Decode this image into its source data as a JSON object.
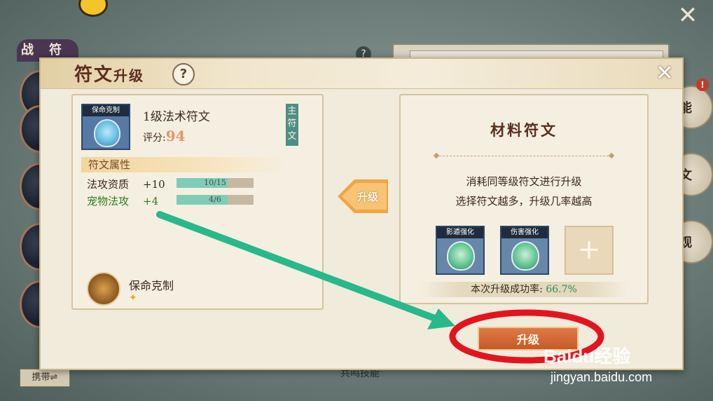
{
  "background": {
    "left_tabs": [
      "战",
      "符"
    ],
    "right_tabs": [
      "能",
      "文",
      "观"
    ],
    "red_dot": "!",
    "carry_button": "携带⇌",
    "resonance_label": "共鸣技能"
  },
  "dialog": {
    "title_main": "符文",
    "title_sub": "升级",
    "help": "?",
    "close": "✕",
    "left_card": {
      "rune_icon_label": "保命克制",
      "rune_name": "1级法术符文",
      "score_label": "评分:",
      "score_value": "94",
      "main_tag": "主符文",
      "attributes_header": "符文属性",
      "attributes": [
        {
          "name": "法攻资质",
          "plus": "+10",
          "progress_text": "10/15",
          "progress": 0.6667,
          "color": "#3b2a1e"
        },
        {
          "name": "宠物法攻",
          "plus": "+4",
          "progress_text": "4/6",
          "progress": 0.6667,
          "color": "#2e7d1f"
        }
      ],
      "skill_name": "保命克制"
    },
    "arrow_label": "升级",
    "right_card": {
      "title": "材料符文",
      "desc1": "消耗同等级符文进行升级",
      "desc2": "选择符文越多，升级几率越高",
      "slots": [
        "影遁强化",
        "伤害强化"
      ],
      "add": "+",
      "success_label": "本次升级成功率:",
      "success_value": "66.7%"
    },
    "upgrade_button": "升级"
  },
  "watermark": {
    "brand": "Baidu经验",
    "url": "jingyan.baidu.com"
  },
  "colors": {
    "annotation_arrow": "#27b98a",
    "annotation_circle": "#e3141e"
  }
}
